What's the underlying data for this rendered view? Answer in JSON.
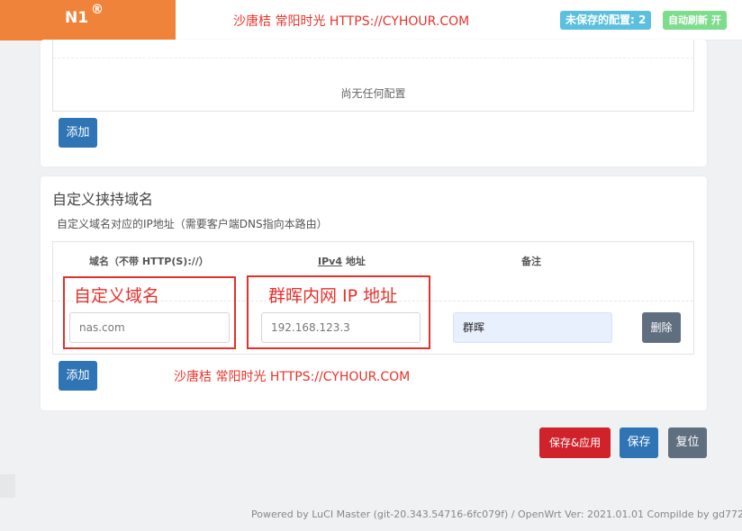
{
  "header": {
    "brand": "N1",
    "brand_mark": "®",
    "watermark": "沙唐桔 常阳时光 HTTPS://CYHOUR.COM",
    "unsaved_badge": "未保存的配置: 2",
    "refresh_badge": "自动刷新 开"
  },
  "section_top": {
    "empty_text": "尚无任何配置",
    "add_label": "添加"
  },
  "section_hijack": {
    "title": "自定义挟持域名",
    "description": "自定义域名对应的IP地址（需要客户端DNS指向本路由）",
    "columns": {
      "domain": "域名（不带 HTTP(S)://）",
      "ipv4_prefix": "IPv4",
      "ipv4_suffix": " 地址",
      "note": "备注"
    },
    "row": {
      "domain_placeholder": "nas.com",
      "ip_placeholder": "192.168.123.3",
      "note_value": "群晖",
      "delete_label": "删除"
    },
    "add_label": "添加",
    "annotation_domain": "自定义域名",
    "annotation_ip": "群晖内网 IP 地址",
    "watermark": "沙唐桔 常阳时光 HTTPS://CYHOUR.COM"
  },
  "actions": {
    "save_apply": "保存&应用",
    "save": "保存",
    "reset": "复位"
  },
  "footer": {
    "text": "Powered by LuCI Master (git-20.343.54716-6fc079f) / OpenWrt Ver: 2021.01.01 Compilde by gd772"
  },
  "colors": {
    "brand": "#f0833a",
    "primary": "#2f74b5",
    "danger": "#d0222a",
    "secondary": "#606f80",
    "annotation": "#e5312b"
  }
}
